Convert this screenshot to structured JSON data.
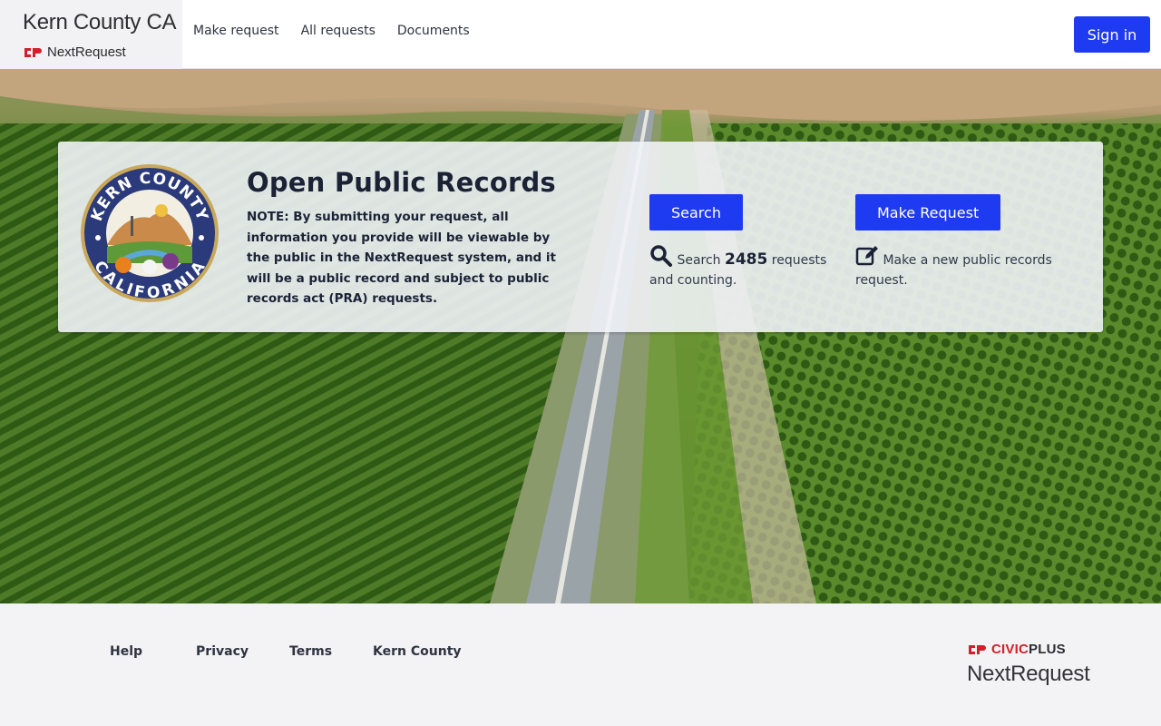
{
  "header": {
    "brand_title": "Kern County CA",
    "brand_sub": "NextRequest",
    "nav": [
      "Make request",
      "All requests",
      "Documents"
    ],
    "signin_label": "Sign in"
  },
  "hero": {
    "title": "Open Public Records",
    "note": "NOTE: By submitting your request, all information you provide will be viewable by the public in the NextRequest system, and it will be a public record and subject to public records act (PRA) requests.",
    "seal": {
      "top_text": "KERN COUNTY",
      "bottom_text": "CALIFORNIA",
      "icon": "kern-county-seal"
    },
    "search": {
      "button_label": "Search",
      "desc_prefix": "Search",
      "count": "2485",
      "desc_suffix": "requests and counting.",
      "icon": "search-icon"
    },
    "make": {
      "button_label": "Make Request",
      "desc": "Make a new public records request.",
      "icon": "edit-icon"
    }
  },
  "footer": {
    "links": [
      "Help",
      "Privacy",
      "Terms",
      "Kern County"
    ],
    "civicplus_civic": "CIVIC",
    "civicplus_plus": "PLUS",
    "nextrequest": "NextRequest"
  },
  "colors": {
    "accent": "#1f3bf2",
    "civicplus_red": "#d21f2b",
    "text_dark": "#1b2236"
  }
}
